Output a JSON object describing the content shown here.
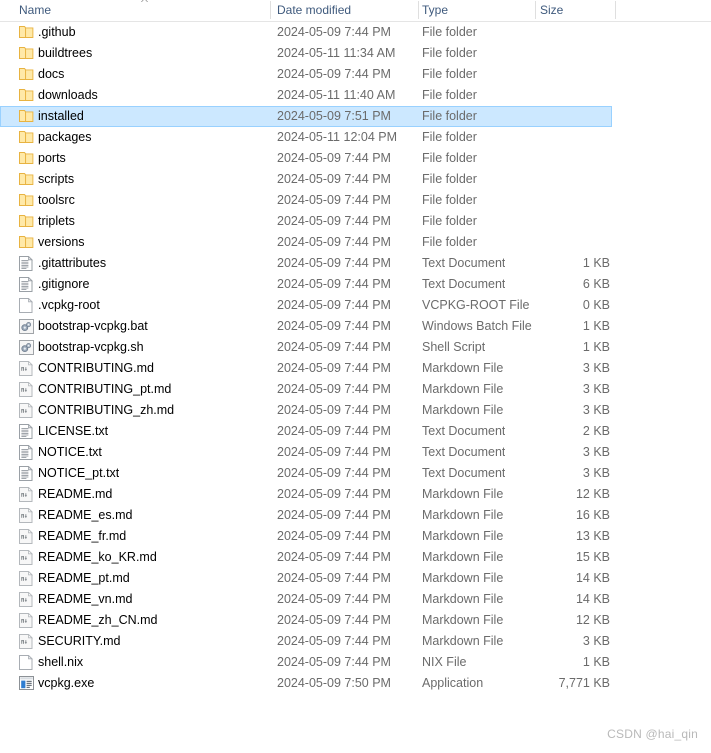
{
  "columns": {
    "name": "Name",
    "date_modified": "Date modified",
    "type": "Type",
    "size": "Size",
    "sort_indicator": "sort-ascending"
  },
  "colors": {
    "header_text": "#3f5a7d",
    "selection_fill": "#cce8ff",
    "selection_border": "#99d1ff",
    "folder_body": "#ffe9a8",
    "folder_edge": "#e8b341",
    "watermark": "#b9b9b9"
  },
  "rows": [
    {
      "name": ".github",
      "date": "2024-05-09 7:44 PM",
      "type": "File folder",
      "size": "",
      "icon": "folder-icon",
      "selected": false
    },
    {
      "name": "buildtrees",
      "date": "2024-05-11 11:34 AM",
      "type": "File folder",
      "size": "",
      "icon": "folder-icon",
      "selected": false
    },
    {
      "name": "docs",
      "date": "2024-05-09 7:44 PM",
      "type": "File folder",
      "size": "",
      "icon": "folder-icon",
      "selected": false
    },
    {
      "name": "downloads",
      "date": "2024-05-11 11:40 AM",
      "type": "File folder",
      "size": "",
      "icon": "folder-icon",
      "selected": false
    },
    {
      "name": "installed",
      "date": "2024-05-09 7:51 PM",
      "type": "File folder",
      "size": "",
      "icon": "folder-icon",
      "selected": true
    },
    {
      "name": "packages",
      "date": "2024-05-11 12:04 PM",
      "type": "File folder",
      "size": "",
      "icon": "folder-icon",
      "selected": false
    },
    {
      "name": "ports",
      "date": "2024-05-09 7:44 PM",
      "type": "File folder",
      "size": "",
      "icon": "folder-icon",
      "selected": false
    },
    {
      "name": "scripts",
      "date": "2024-05-09 7:44 PM",
      "type": "File folder",
      "size": "",
      "icon": "folder-icon",
      "selected": false
    },
    {
      "name": "toolsrc",
      "date": "2024-05-09 7:44 PM",
      "type": "File folder",
      "size": "",
      "icon": "folder-icon",
      "selected": false
    },
    {
      "name": "triplets",
      "date": "2024-05-09 7:44 PM",
      "type": "File folder",
      "size": "",
      "icon": "folder-icon",
      "selected": false
    },
    {
      "name": "versions",
      "date": "2024-05-09 7:44 PM",
      "type": "File folder",
      "size": "",
      "icon": "folder-icon",
      "selected": false
    },
    {
      "name": ".gitattributes",
      "date": "2024-05-09 7:44 PM",
      "type": "Text Document",
      "size": "1 KB",
      "icon": "text-document-icon",
      "selected": false
    },
    {
      "name": ".gitignore",
      "date": "2024-05-09 7:44 PM",
      "type": "Text Document",
      "size": "6 KB",
      "icon": "text-document-icon",
      "selected": false
    },
    {
      "name": ".vcpkg-root",
      "date": "2024-05-09 7:44 PM",
      "type": "VCPKG-ROOT File",
      "size": "0 KB",
      "icon": "blank-document-icon",
      "selected": false
    },
    {
      "name": "bootstrap-vcpkg.bat",
      "date": "2024-05-09 7:44 PM",
      "type": "Windows Batch File",
      "size": "1 KB",
      "icon": "script-gear-icon",
      "selected": false
    },
    {
      "name": "bootstrap-vcpkg.sh",
      "date": "2024-05-09 7:44 PM",
      "type": "Shell Script",
      "size": "1 KB",
      "icon": "script-gear-icon",
      "selected": false
    },
    {
      "name": "CONTRIBUTING.md",
      "date": "2024-05-09 7:44 PM",
      "type": "Markdown File",
      "size": "3 KB",
      "icon": "markdown-icon",
      "selected": false
    },
    {
      "name": "CONTRIBUTING_pt.md",
      "date": "2024-05-09 7:44 PM",
      "type": "Markdown File",
      "size": "3 KB",
      "icon": "markdown-icon",
      "selected": false
    },
    {
      "name": "CONTRIBUTING_zh.md",
      "date": "2024-05-09 7:44 PM",
      "type": "Markdown File",
      "size": "3 KB",
      "icon": "markdown-icon",
      "selected": false
    },
    {
      "name": "LICENSE.txt",
      "date": "2024-05-09 7:44 PM",
      "type": "Text Document",
      "size": "2 KB",
      "icon": "text-document-icon",
      "selected": false
    },
    {
      "name": "NOTICE.txt",
      "date": "2024-05-09 7:44 PM",
      "type": "Text Document",
      "size": "3 KB",
      "icon": "text-document-icon",
      "selected": false
    },
    {
      "name": "NOTICE_pt.txt",
      "date": "2024-05-09 7:44 PM",
      "type": "Text Document",
      "size": "3 KB",
      "icon": "text-document-icon",
      "selected": false
    },
    {
      "name": "README.md",
      "date": "2024-05-09 7:44 PM",
      "type": "Markdown File",
      "size": "12 KB",
      "icon": "markdown-icon",
      "selected": false
    },
    {
      "name": "README_es.md",
      "date": "2024-05-09 7:44 PM",
      "type": "Markdown File",
      "size": "16 KB",
      "icon": "markdown-icon",
      "selected": false
    },
    {
      "name": "README_fr.md",
      "date": "2024-05-09 7:44 PM",
      "type": "Markdown File",
      "size": "13 KB",
      "icon": "markdown-icon",
      "selected": false
    },
    {
      "name": "README_ko_KR.md",
      "date": "2024-05-09 7:44 PM",
      "type": "Markdown File",
      "size": "15 KB",
      "icon": "markdown-icon",
      "selected": false
    },
    {
      "name": "README_pt.md",
      "date": "2024-05-09 7:44 PM",
      "type": "Markdown File",
      "size": "14 KB",
      "icon": "markdown-icon",
      "selected": false
    },
    {
      "name": "README_vn.md",
      "date": "2024-05-09 7:44 PM",
      "type": "Markdown File",
      "size": "14 KB",
      "icon": "markdown-icon",
      "selected": false
    },
    {
      "name": "README_zh_CN.md",
      "date": "2024-05-09 7:44 PM",
      "type": "Markdown File",
      "size": "12 KB",
      "icon": "markdown-icon",
      "selected": false
    },
    {
      "name": "SECURITY.md",
      "date": "2024-05-09 7:44 PM",
      "type": "Markdown File",
      "size": "3 KB",
      "icon": "markdown-icon",
      "selected": false
    },
    {
      "name": "shell.nix",
      "date": "2024-05-09 7:44 PM",
      "type": "NIX File",
      "size": "1 KB",
      "icon": "blank-document-icon",
      "selected": false
    },
    {
      "name": "vcpkg.exe",
      "date": "2024-05-09 7:50 PM",
      "type": "Application",
      "size": "7,771 KB",
      "icon": "application-icon",
      "selected": false
    }
  ],
  "watermark": "CSDN @hai_qin"
}
